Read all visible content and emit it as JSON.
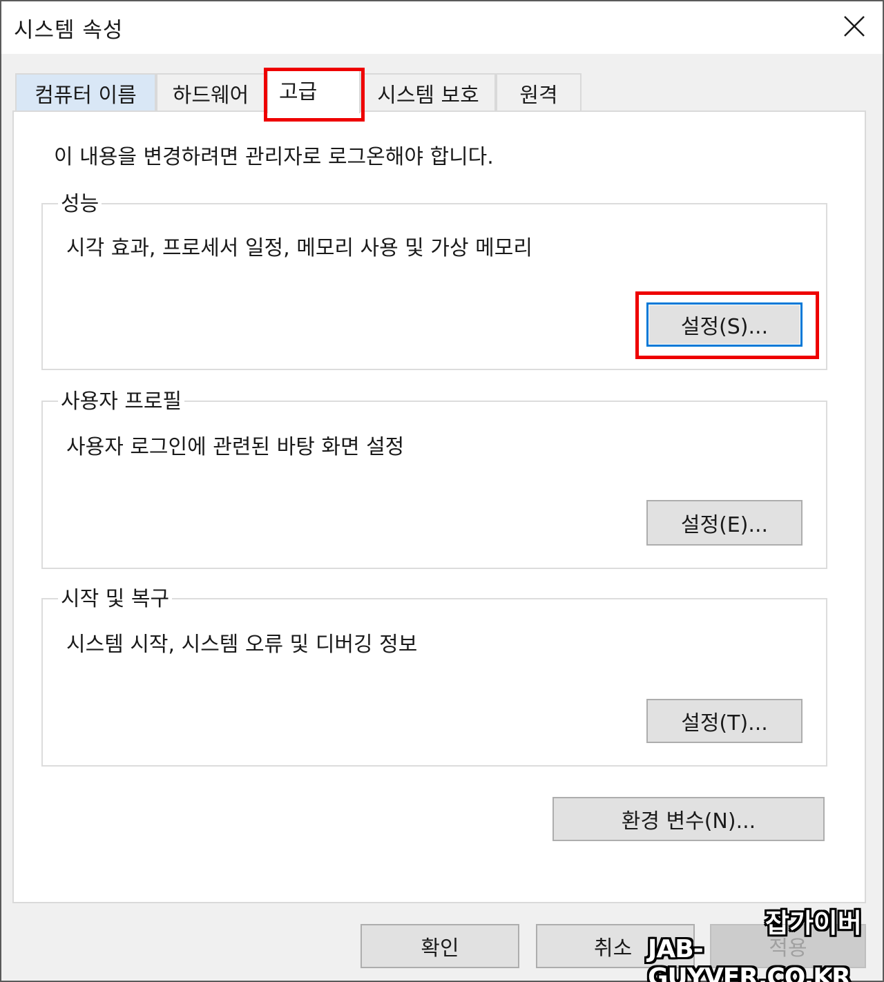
{
  "window": {
    "title": "시스템 속성"
  },
  "tabs": [
    {
      "label": "컴퓨터 이름"
    },
    {
      "label": "하드웨어"
    },
    {
      "label": "고급"
    },
    {
      "label": "시스템 보호"
    },
    {
      "label": "원격"
    }
  ],
  "active_tab": "고급",
  "notice": "이 내용을 변경하려면 관리자로 로그온해야 합니다.",
  "performance": {
    "label": "성능",
    "description": "시각 효과, 프로세서 일정, 메모리 사용 및 가상 메모리",
    "button": "설정(S)..."
  },
  "user_profiles": {
    "label": "사용자 프로필",
    "description": "사용자 로그인에 관련된 바탕 화면 설정",
    "button": "설정(E)..."
  },
  "startup_recovery": {
    "label": "시작 및 복구",
    "description": "시스템 시작, 시스템 오류 및 디버깅 정보",
    "button": "설정(T)..."
  },
  "env_button": "환경 변수(N)...",
  "footer": {
    "ok": "확인",
    "cancel": "취소",
    "apply": "적용"
  },
  "watermark": {
    "line1": "잡가이버",
    "line2": "JAB-GUYVER.CO.KR"
  },
  "colors": {
    "highlight": "#ee0000",
    "focus_border": "#0078d7",
    "first_tab_bg": "#d9e7f6"
  },
  "icons": {
    "close": "close-icon"
  }
}
